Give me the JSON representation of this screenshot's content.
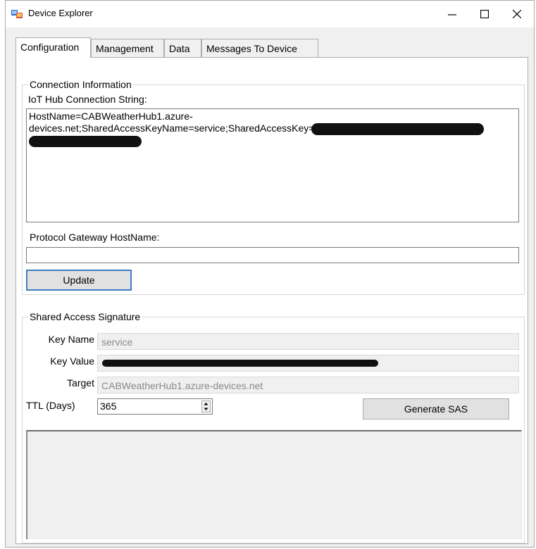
{
  "window": {
    "title": "Device Explorer",
    "icon": "device-explorer-icon"
  },
  "tabs": [
    {
      "label": "Configuration",
      "active": true
    },
    {
      "label": "Management"
    },
    {
      "label": "Data"
    },
    {
      "label": "Messages To Device"
    }
  ],
  "connection": {
    "group_label": "Connection Information",
    "conn_label": "IoT Hub Connection String:",
    "conn_line1": "HostName=CABWeatherHub1.azure-",
    "conn_line2": "devices.net;SharedAccessKeyName=service;SharedAccessKey=",
    "gateway_label": "Protocol Gateway HostName:",
    "gateway_value": "",
    "update_button": "Update"
  },
  "sas": {
    "group_label": "Shared Access Signature",
    "key_name_label": "Key Name",
    "key_name_value": "service",
    "key_value_label": "Key Value",
    "target_label": "Target",
    "target_value": "CABWeatherHub1.azure-devices.net",
    "ttl_label": "TTL (Days)",
    "ttl_value": "365",
    "generate_button": "Generate SAS",
    "output": ""
  }
}
